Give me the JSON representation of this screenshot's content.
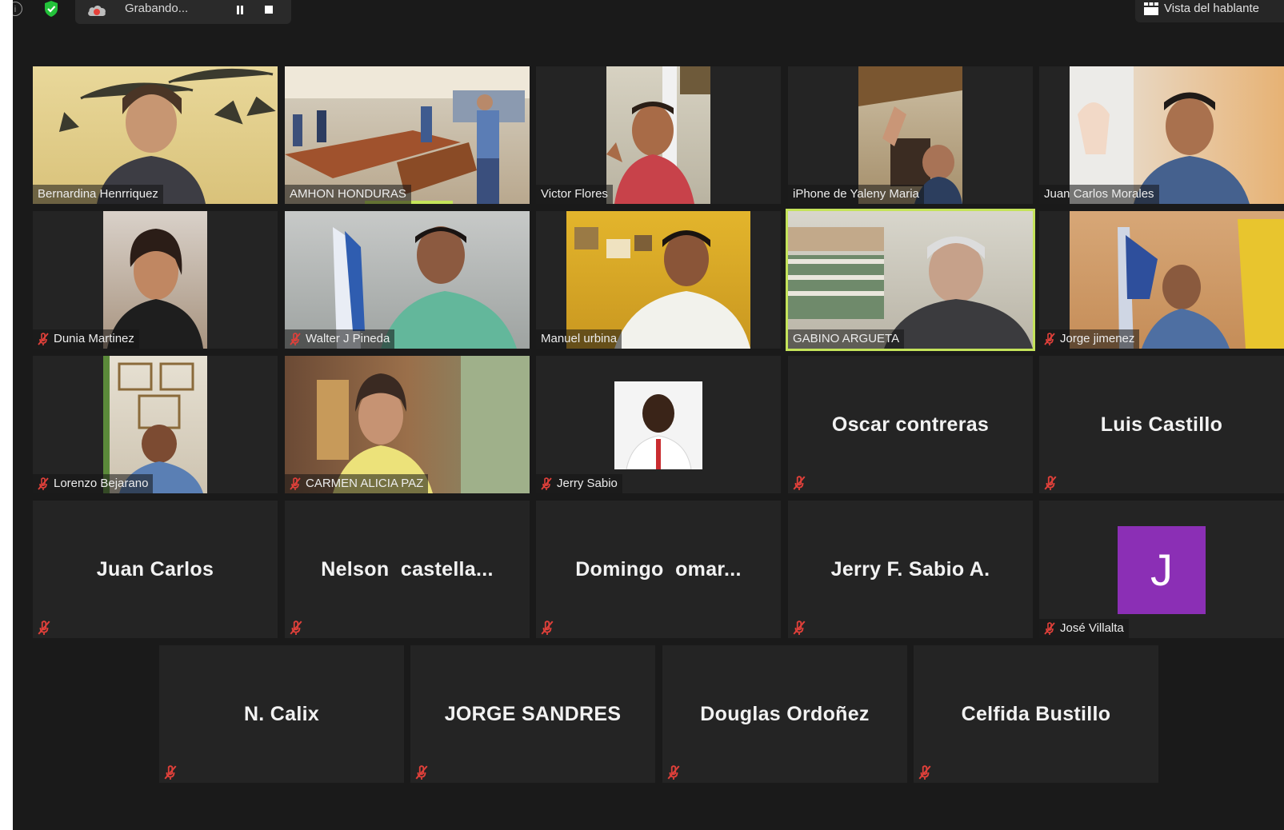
{
  "toolbar": {
    "info_icon": "info-icon",
    "security_icon": "shield-check-icon",
    "recording_icon": "cloud-record-icon",
    "recording_label": "Grabando...",
    "pause_icon": "pause-icon",
    "stop_icon": "stop-icon",
    "view_icon": "grid-icon",
    "view_label": "Vista del hablante"
  },
  "colors": {
    "background": "#1a1a1a",
    "tile": "#242424",
    "active_speaker": "#c4e35a",
    "muted": "#e0403a",
    "avatar": "#8b2fb5"
  },
  "participants": [
    {
      "name": "Bernardina Henrriquez",
      "video": true,
      "muted": false
    },
    {
      "name": "AMHON HONDURAS",
      "video": true,
      "muted": false,
      "speaking": true
    },
    {
      "name": "Victor Flores",
      "video": true,
      "muted": false
    },
    {
      "name": "iPhone de Yaleny Maria",
      "video": true,
      "muted": false
    },
    {
      "name": "Juan Carlos Morales",
      "video": true,
      "muted": false
    },
    {
      "name": "Dunia Martinez",
      "video": true,
      "muted": true
    },
    {
      "name": "Walter J Pineda",
      "video": true,
      "muted": true
    },
    {
      "name": "Manuel urbina",
      "video": true,
      "muted": false
    },
    {
      "name": "GABINO ARGUETA",
      "video": true,
      "muted": false,
      "active": true
    },
    {
      "name": "Jorge jimenez",
      "video": true,
      "muted": true
    },
    {
      "name": "Lorenzo Bejarano",
      "video": true,
      "muted": true
    },
    {
      "name": "CARMEN ALICIA PAZ",
      "video": true,
      "muted": true
    },
    {
      "name": "Jerry Sabio",
      "video": true,
      "muted": true
    },
    {
      "name": "Oscar contreras",
      "video": false,
      "muted": true
    },
    {
      "name": "Luis Castillo",
      "video": false,
      "muted": true
    },
    {
      "name": "Juan Carlos",
      "video": false,
      "muted": true
    },
    {
      "name": "Nelson  castella...",
      "video": false,
      "muted": true
    },
    {
      "name": "Domingo  omar...",
      "video": false,
      "muted": true
    },
    {
      "name": "Jerry F. Sabio A.",
      "video": false,
      "muted": true
    },
    {
      "name": "José Villalta",
      "video": false,
      "muted": true,
      "avatar_letter": "J"
    },
    {
      "name": "N. Calix",
      "video": false,
      "muted": true
    },
    {
      "name": "JORGE SANDRES",
      "video": false,
      "muted": true
    },
    {
      "name": "Douglas Ordoñez",
      "video": false,
      "muted": true
    },
    {
      "name": "Celfida Bustillo",
      "video": false,
      "muted": true
    }
  ]
}
